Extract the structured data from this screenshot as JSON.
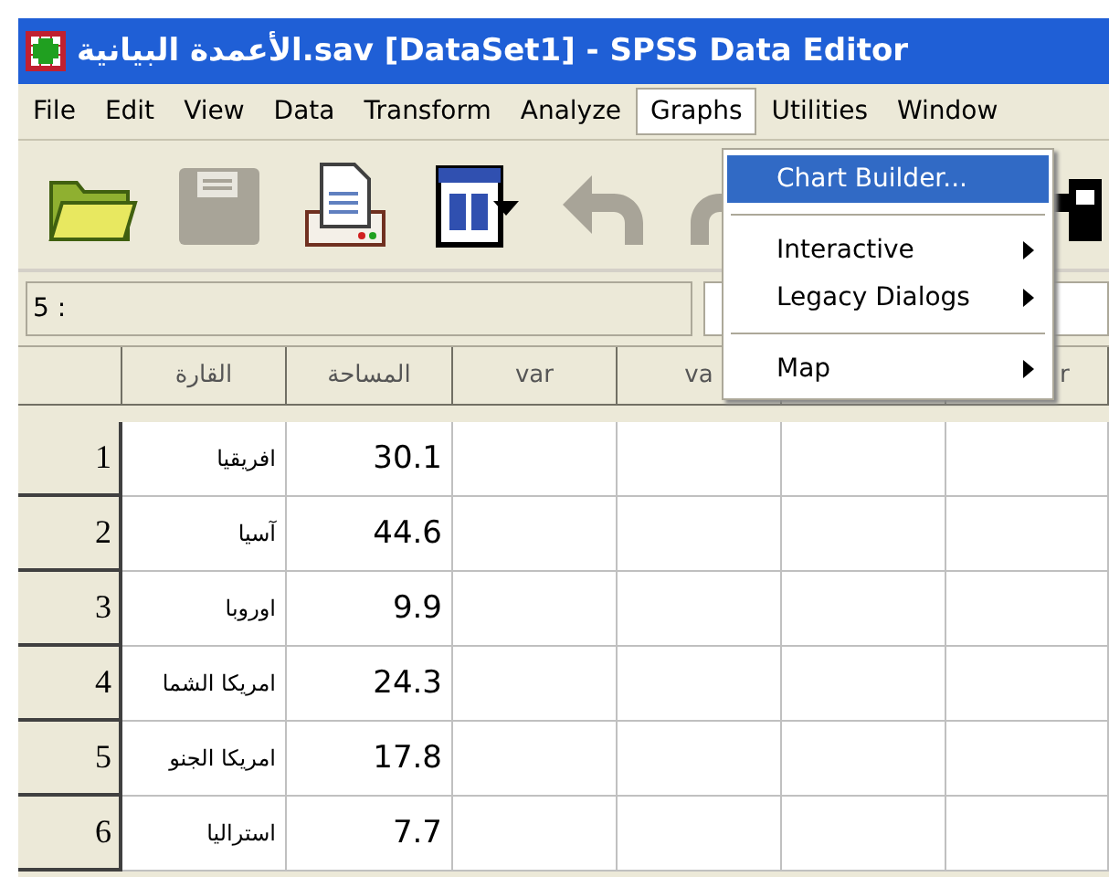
{
  "window": {
    "title": "الأعمدة البيانية.sav [DataSet1] - SPSS Data Editor"
  },
  "menu_bar": [
    {
      "label": "File",
      "selected": false
    },
    {
      "label": "Edit",
      "selected": false
    },
    {
      "label": "View",
      "selected": false
    },
    {
      "label": "Data",
      "selected": false
    },
    {
      "label": "Transform",
      "selected": false
    },
    {
      "label": "Analyze",
      "selected": false
    },
    {
      "label": "Graphs",
      "selected": true
    },
    {
      "label": "Utilities",
      "selected": false
    },
    {
      "label": "Window",
      "selected": false
    }
  ],
  "toolbar": [
    {
      "kind": "open",
      "disabled": false
    },
    {
      "kind": "save",
      "disabled": true
    },
    {
      "kind": "print",
      "disabled": false
    },
    {
      "kind": "dialog",
      "disabled": false
    },
    {
      "kind": "undo",
      "disabled": true
    },
    {
      "kind": "redo",
      "disabled": true
    },
    {
      "kind": "find",
      "disabled": false
    }
  ],
  "cell_editor": {
    "cell_ref": "5 :"
  },
  "table": {
    "columns": [
      "",
      "القارة",
      "المساحة",
      "var",
      "va",
      "r"
    ],
    "rows": [
      [
        "1",
        "افريقيا",
        "30.1"
      ],
      [
        "2",
        "آسيا",
        "44.6"
      ],
      [
        "3",
        "اوروبا",
        "9.9"
      ],
      [
        "4",
        "امريكا الشما",
        "24.3"
      ],
      [
        "5",
        "امريكا الجنو",
        "17.8"
      ],
      [
        "6",
        "استراليا",
        "7.7"
      ]
    ]
  },
  "dropdown": {
    "items": [
      {
        "kind": "item",
        "label": "Chart Builder...",
        "selected": true,
        "submenu": false
      },
      {
        "kind": "separator"
      },
      {
        "kind": "item",
        "label": "Interactive",
        "selected": false,
        "submenu": true
      },
      {
        "kind": "item",
        "label": "Legacy Dialogs",
        "selected": false,
        "submenu": true
      },
      {
        "kind": "separator"
      },
      {
        "kind": "item",
        "label": "Map",
        "selected": false,
        "submenu": true
      }
    ]
  }
}
